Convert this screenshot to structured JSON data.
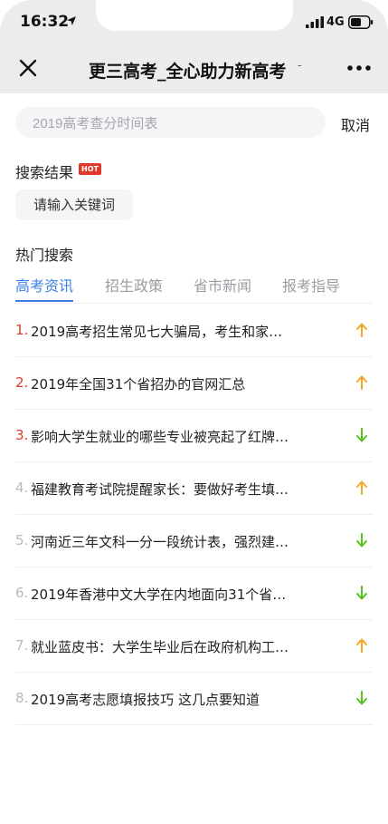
{
  "status_bar": {
    "time": "16:32",
    "network": "4G"
  },
  "nav": {
    "title": "更三高考_全心助力新高考",
    "title_suffix": "-"
  },
  "search": {
    "placeholder": "2019高考查分时间表",
    "value": "",
    "cancel_label": "取消"
  },
  "results": {
    "title": "搜索结果",
    "hot_badge": "HOT",
    "keyword_hint": "请输入关键词"
  },
  "hot_search": {
    "title": "热门搜索",
    "tabs": [
      {
        "label": "高考资讯",
        "active": true
      },
      {
        "label": "招生政策",
        "active": false
      },
      {
        "label": "省市新闻",
        "active": false
      },
      {
        "label": "报考指导",
        "active": false
      }
    ],
    "items": [
      {
        "rank": "1.",
        "text": "2019高考招生常见七大骗局，考生和家…",
        "trend": "up"
      },
      {
        "rank": "2.",
        "text": "2019年全国31个省招办的官网汇总",
        "trend": "up"
      },
      {
        "rank": "3.",
        "text": "影响大学生就业的哪些专业被亮起了红牌…",
        "trend": "down"
      },
      {
        "rank": "4.",
        "text": "福建教育考试院提醒家长：要做好考生填…",
        "trend": "up"
      },
      {
        "rank": "5.",
        "text": "河南近三年文科一分一段统计表，强烈建…",
        "trend": "down"
      },
      {
        "rank": "6.",
        "text": "2019年香港中文大学在内地面向31个省…",
        "trend": "down"
      },
      {
        "rank": "7.",
        "text": "就业蓝皮书：大学生毕业后在政府机构工…",
        "trend": "up"
      },
      {
        "rank": "8.",
        "text": "2019高考志愿填报技巧 这几点要知道",
        "trend": "down"
      }
    ]
  },
  "colors": {
    "accent": "#3d7fe3",
    "hot_red": "#e2382a",
    "up": "#f5a623",
    "down": "#52c41a"
  },
  "icons": {
    "close": "close-icon",
    "more": "more-icon",
    "location": "location-arrow-icon",
    "signal": "signal-icon",
    "battery": "battery-icon",
    "up": "arrow-up-icon",
    "down": "arrow-down-icon"
  }
}
